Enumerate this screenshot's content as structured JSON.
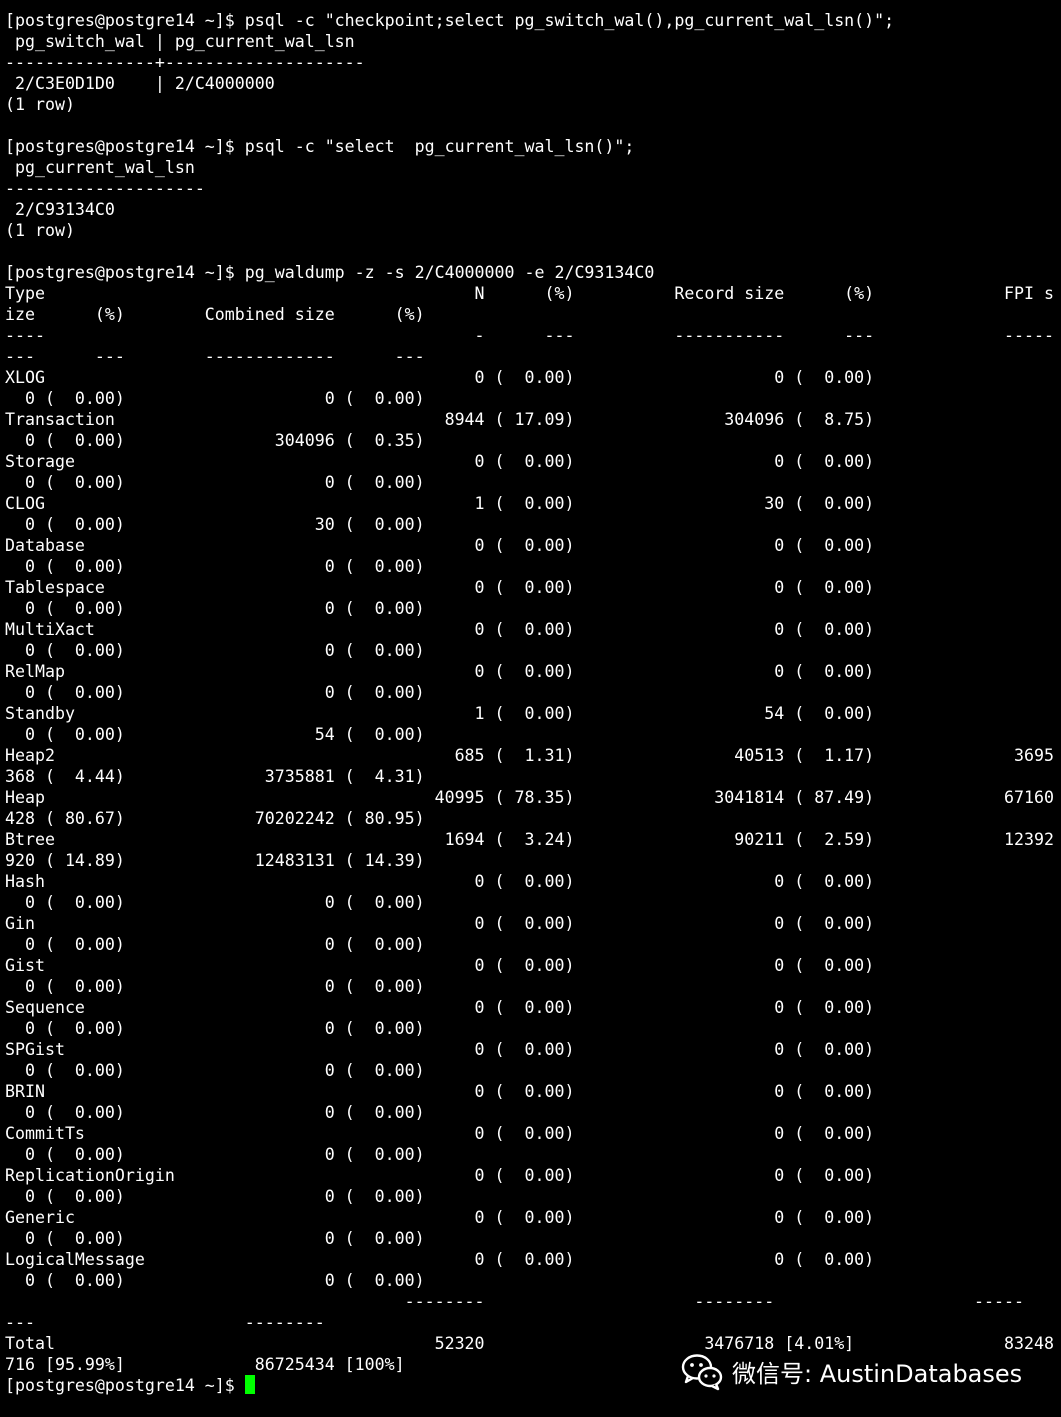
{
  "terminal": {
    "lines": [
      "[postgres@postgre14 ~]$ psql -c \"checkpoint;select pg_switch_wal(),pg_current_wal_lsn()\";",
      " pg_switch_wal | pg_current_wal_lsn",
      "---------------+--------------------",
      " 2/C3E0D1D0    | 2/C4000000",
      "(1 row)",
      "",
      "[postgres@postgre14 ~]$ psql -c \"select  pg_current_wal_lsn()\";",
      " pg_current_wal_lsn",
      "--------------------",
      " 2/C93134C0",
      "(1 row)",
      "",
      "[postgres@postgre14 ~]$ pg_waldump -z -s 2/C4000000 -e 2/C93134C0",
      "Type                                           N      (%)          Record size      (%)             FPI s",
      "ize      (%)        Combined size      (%)",
      "----                                           -      ---          -----------      ---             -----",
      "---      ---        -------------      ---",
      "XLOG                                           0 (  0.00)                    0 (  0.00)",
      "  0 (  0.00)                    0 (  0.00)",
      "Transaction                                 8944 ( 17.09)               304096 (  8.75)",
      "  0 (  0.00)               304096 (  0.35)",
      "Storage                                        0 (  0.00)                    0 (  0.00)",
      "  0 (  0.00)                    0 (  0.00)",
      "CLOG                                           1 (  0.00)                   30 (  0.00)",
      "  0 (  0.00)                   30 (  0.00)",
      "Database                                       0 (  0.00)                    0 (  0.00)",
      "  0 (  0.00)                    0 (  0.00)",
      "Tablespace                                     0 (  0.00)                    0 (  0.00)",
      "  0 (  0.00)                    0 (  0.00)",
      "MultiXact                                      0 (  0.00)                    0 (  0.00)",
      "  0 (  0.00)                    0 (  0.00)",
      "RelMap                                         0 (  0.00)                    0 (  0.00)",
      "  0 (  0.00)                    0 (  0.00)",
      "Standby                                        1 (  0.00)                   54 (  0.00)",
      "  0 (  0.00)                   54 (  0.00)",
      "Heap2                                        685 (  1.31)                40513 (  1.17)              3695",
      "368 (  4.44)              3735881 (  4.31)",
      "Heap                                       40995 ( 78.35)              3041814 ( 87.49)             67160",
      "428 ( 80.67)             70202242 ( 80.95)",
      "Btree                                       1694 (  3.24)                90211 (  2.59)             12392",
      "920 ( 14.89)             12483131 ( 14.39)",
      "Hash                                           0 (  0.00)                    0 (  0.00)",
      "  0 (  0.00)                    0 (  0.00)",
      "Gin                                            0 (  0.00)                    0 (  0.00)",
      "  0 (  0.00)                    0 (  0.00)",
      "Gist                                           0 (  0.00)                    0 (  0.00)",
      "  0 (  0.00)                    0 (  0.00)",
      "Sequence                                       0 (  0.00)                    0 (  0.00)",
      "  0 (  0.00)                    0 (  0.00)",
      "SPGist                                         0 (  0.00)                    0 (  0.00)",
      "  0 (  0.00)                    0 (  0.00)",
      "BRIN                                           0 (  0.00)                    0 (  0.00)",
      "  0 (  0.00)                    0 (  0.00)",
      "CommitTs                                       0 (  0.00)                    0 (  0.00)",
      "  0 (  0.00)                    0 (  0.00)",
      "ReplicationOrigin                              0 (  0.00)                    0 (  0.00)",
      "  0 (  0.00)                    0 (  0.00)",
      "Generic                                        0 (  0.00)                    0 (  0.00)",
      "  0 (  0.00)                    0 (  0.00)",
      "LogicalMessage                                 0 (  0.00)                    0 (  0.00)",
      "  0 (  0.00)                    0 (  0.00)",
      "                                        --------                     --------                    -----",
      "---                     --------",
      "Total                                      52320                      3476718 [4.01%]               83248",
      "716 [95.99%]             86725434 [100%]"
    ],
    "prompt": "[postgres@postgre14 ~]$ "
  },
  "watermark": {
    "icon": "wechat-icon",
    "text": "微信号: AustinDatabases"
  },
  "colors": {
    "background": "#000000",
    "foreground": "#ffffff",
    "cursor": "#00ff00"
  }
}
